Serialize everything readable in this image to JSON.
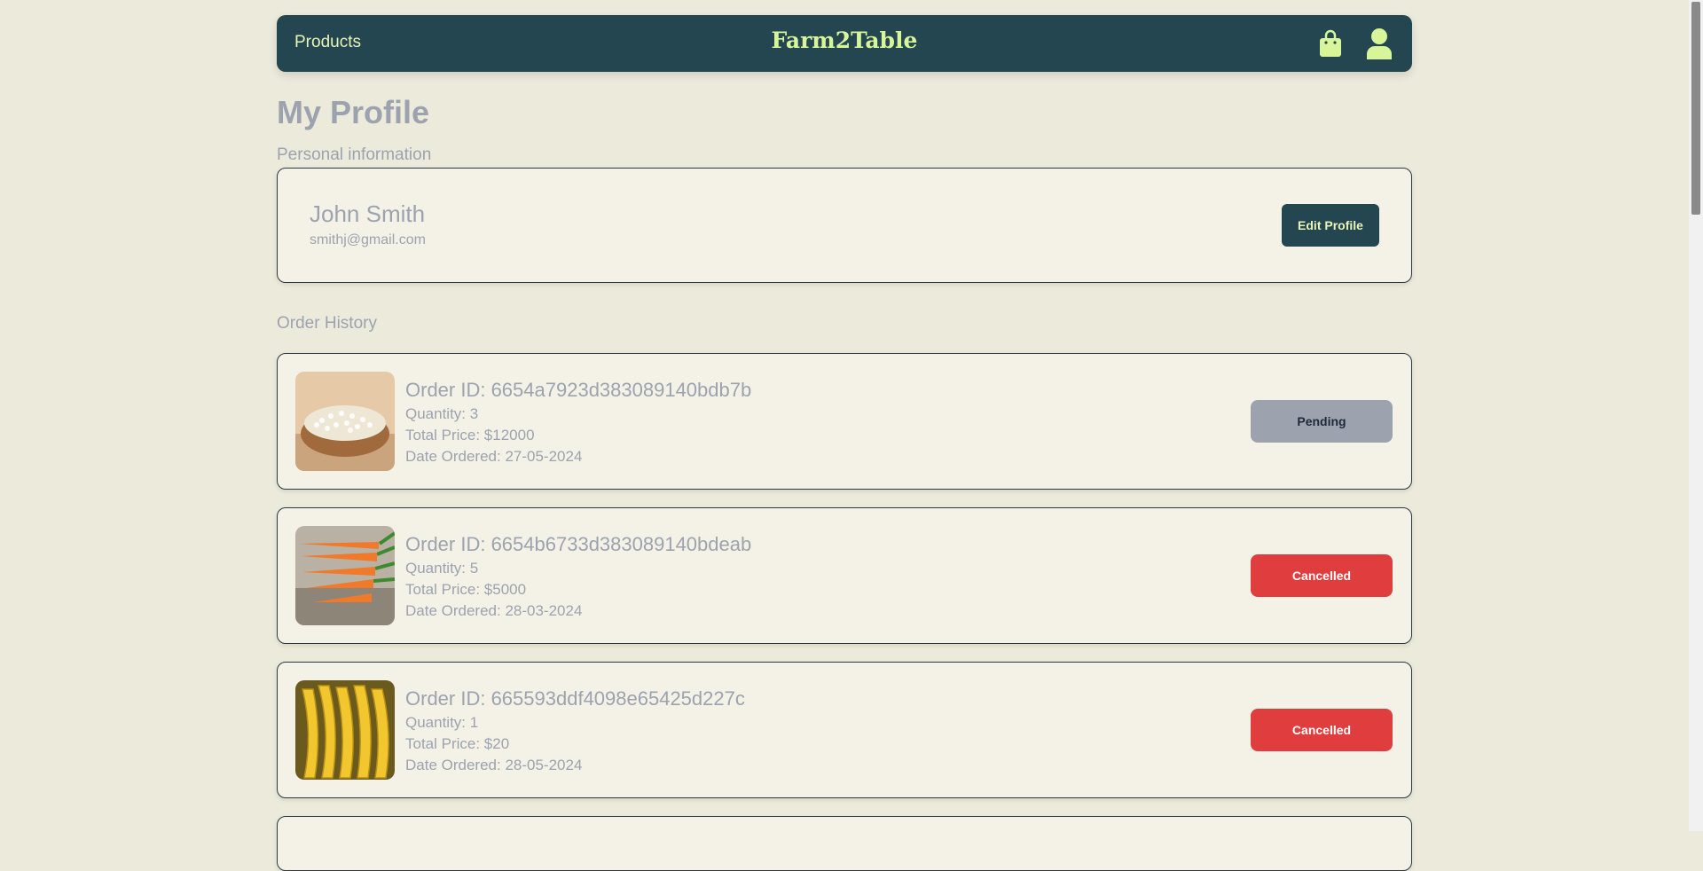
{
  "navbar": {
    "products_label": "Products",
    "brand": "Farm2Table",
    "cart_icon": "shopping-bag-icon",
    "profile_icon": "user-icon"
  },
  "profile": {
    "title": "My Profile",
    "personal_label": "Personal information",
    "name": "John Smith",
    "email": "smithj@gmail.com",
    "edit_label": "Edit Profile"
  },
  "orders": {
    "section_label": "Order History",
    "items": [
      {
        "id": "Order ID: 6654a7923d383089140bdb7b",
        "quantity": "Quantity: 3",
        "total": "Total Price: $12000",
        "date": "Date Ordered: 27-05-2024",
        "status": "Pending",
        "image": "barley-bowl"
      },
      {
        "id": "Order ID: 6654b6733d383089140bdeab",
        "quantity": "Quantity: 5",
        "total": "Total Price: $5000",
        "date": "Date Ordered: 28-03-2024",
        "status": "Cancelled",
        "image": "carrots"
      },
      {
        "id": "Order ID: 665593ddf4098e65425d227c",
        "quantity": "Quantity: 1",
        "total": "Total Price: $20",
        "date": "Date Ordered: 28-05-2024",
        "status": "Cancelled",
        "image": "bananas"
      }
    ]
  },
  "colors": {
    "background": "#eceadb",
    "navbar": "#234650",
    "brand": "#d9f59a",
    "pending": "#9ca3af",
    "cancelled": "#e03e3e"
  }
}
